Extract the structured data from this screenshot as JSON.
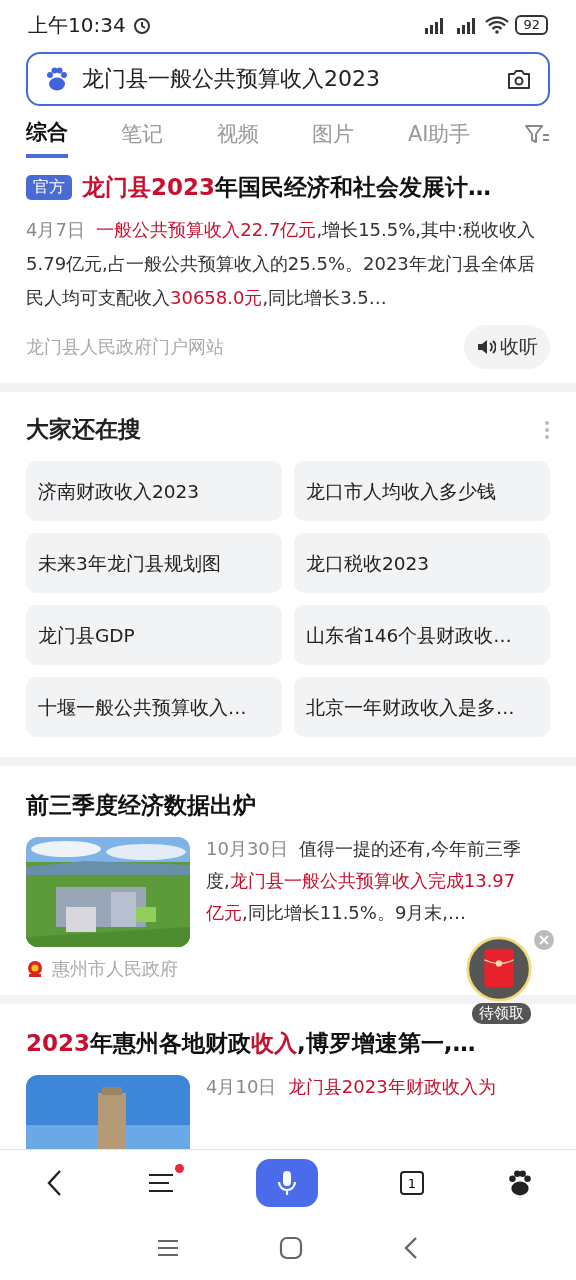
{
  "status_bar": {
    "time": "上午10:34",
    "battery": "92"
  },
  "search": {
    "value": "龙门县一般公共预算收入2023"
  },
  "tabs": [
    {
      "label": "综合",
      "selected": true
    },
    {
      "label": "笔记",
      "selected": false
    },
    {
      "label": "视频",
      "selected": false
    },
    {
      "label": "图片",
      "selected": false
    },
    {
      "label": "AI助手",
      "selected": false
    }
  ],
  "results": [
    {
      "kind": "official",
      "badge": "官方",
      "title": [
        {
          "text": "龙门县2023",
          "highlight": true
        },
        {
          "text": "年国民经济和社会发展计…",
          "highlight": false
        }
      ],
      "date": "4月7日",
      "snippet": [
        {
          "text": "一般公共预算收入22.7亿元",
          "highlight": true
        },
        {
          "text": ",增长15.5%,其中:税收收入5.79亿元,占一般公共预算收入的25.5%。2023年龙门县全体居民人均可支配收入",
          "highlight": false
        },
        {
          "text": "30658.0元",
          "highlight": true
        },
        {
          "text": ",同比增长3.5…",
          "highlight": false
        }
      ],
      "source": "龙门县人民政府门户网站",
      "listen": "收听"
    },
    {
      "kind": "related",
      "title": "大家还在搜",
      "items": [
        "济南财政收入2023",
        "龙口市人均收入多少钱",
        "未来3年龙门县规划图",
        "龙口税收2023",
        "龙门县GDP",
        "山东省146个县财政收…",
        "十堰一般公共预算收入…",
        "北京一年财政收入是多…"
      ]
    },
    {
      "title": [
        {
          "text": "前三季度经济数据出炉",
          "highlight": false
        }
      ],
      "date": "10月30日",
      "snippet": [
        {
          "text": "值得一提的还有,今年前三季度,",
          "highlight": false
        },
        {
          "text": "龙门县一般公共预算收入完成13.97亿元",
          "highlight": true
        },
        {
          "text": ",同比增长11.5%。9月末,…",
          "highlight": false
        }
      ],
      "source": "惠州市人民政府"
    },
    {
      "title": [
        {
          "text": "2023",
          "highlight": true
        },
        {
          "text": "年惠州各地财政",
          "highlight": false
        },
        {
          "text": "收入",
          "highlight": true
        },
        {
          "text": ",博罗增速第一,…",
          "highlight": false
        }
      ],
      "date": "4月10日",
      "snippet": [
        {
          "text": "龙门县2023年财政收入为",
          "highlight": true
        }
      ]
    }
  ],
  "red_packet": {
    "label": "待领取"
  },
  "bottom_bar": {
    "menu_badge": true,
    "tab_count": "1"
  }
}
